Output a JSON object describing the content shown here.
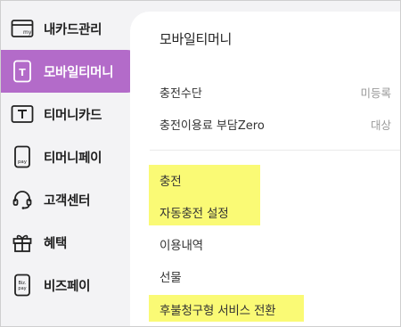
{
  "sidebar": {
    "items": [
      {
        "label": "내카드관리",
        "icon": "card-my-icon"
      },
      {
        "label": "모바일티머니",
        "icon": "mobile-tmoney-icon",
        "active": true
      },
      {
        "label": "티머니카드",
        "icon": "tmoney-card-icon"
      },
      {
        "label": "티머니페이",
        "icon": "phone-pay-icon"
      },
      {
        "label": "고객센터",
        "icon": "headset-icon"
      },
      {
        "label": "혜택",
        "icon": "gift-icon"
      },
      {
        "label": "비즈페이",
        "icon": "biz-pay-icon"
      }
    ],
    "icon_texts": {
      "my": "my",
      "pay": "pay",
      "biz_top": "Biz.",
      "biz_bottom": "pay",
      "t": "T"
    }
  },
  "main": {
    "title": "모바일티머니",
    "settings": [
      {
        "label": "충전수단",
        "value": "미등록"
      },
      {
        "label": "충전이용료 부담Zero",
        "value": "대상"
      }
    ],
    "menu": [
      {
        "label": "충전",
        "highlighted": true
      },
      {
        "label": "자동충전 설정",
        "highlighted": true
      },
      {
        "label": "이용내역",
        "highlighted": false
      },
      {
        "label": "선물",
        "highlighted": false
      },
      {
        "label": "후불청구형 서비스 전환",
        "highlighted": true
      }
    ]
  },
  "colors": {
    "accent": "#b36bc9",
    "highlight": "#fafa75",
    "sidebar_bg": "#f3f3f5",
    "muted_text": "#9a9a9a"
  }
}
